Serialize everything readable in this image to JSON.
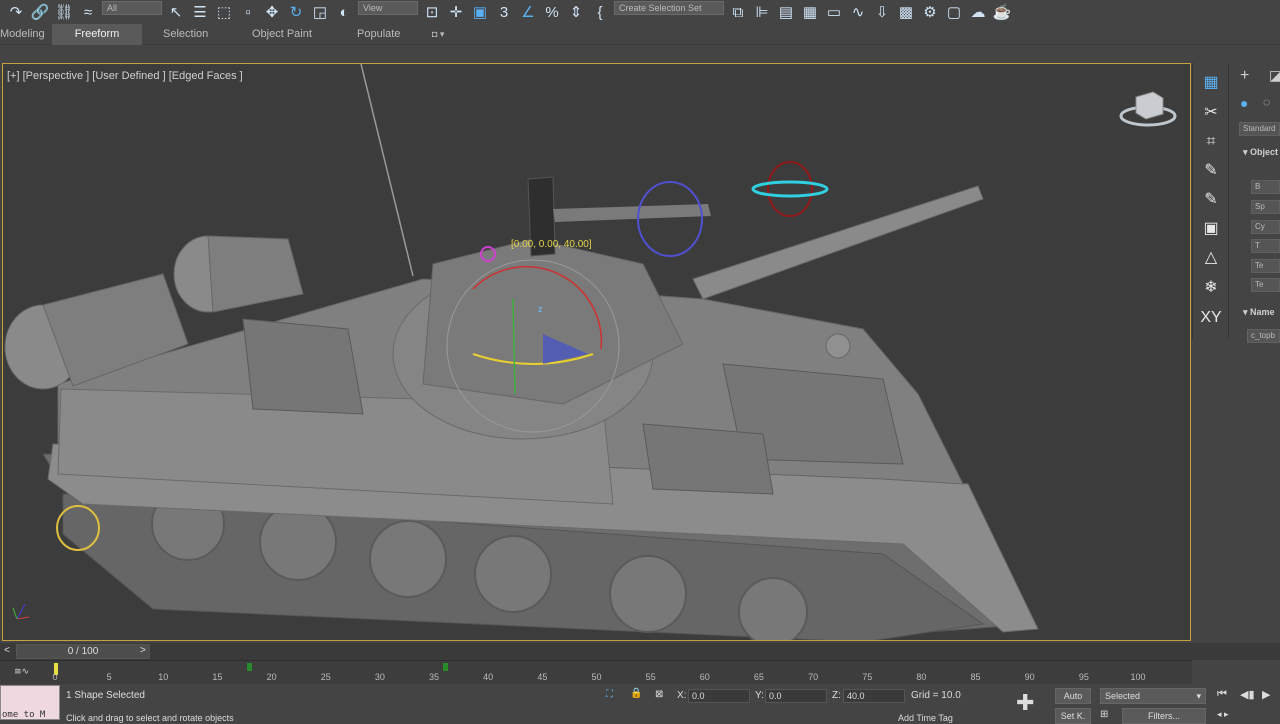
{
  "toolbar": {
    "filter_dropdown": "All",
    "view_dropdown": "View",
    "selection_set_dropdown": "Create Selection Set",
    "snap_value": "3"
  },
  "ribbon": {
    "tabs": [
      {
        "label": "Modeling"
      },
      {
        "label": "Freeform"
      },
      {
        "label": "Selection"
      },
      {
        "label": "Object Paint"
      },
      {
        "label": "Populate"
      }
    ],
    "active_tab": "Freeform"
  },
  "viewport": {
    "label": "[+] [Perspective ] [User Defined ] [Edged Faces ]",
    "gizmo_coordinate": "[0.00, 0.00, 40.00]",
    "axis_z": "z"
  },
  "command_panel": {
    "dropdown": "Standard",
    "rollout_object_type": "Object",
    "buttons": [
      "B",
      "Sp",
      "Cy",
      "T",
      "Te",
      "Te"
    ],
    "rollout_name": "Name",
    "name_value": "c_topb"
  },
  "timeline": {
    "slider_label": "0 / 100",
    "prev_arrow": "<",
    "next_arrow": ">",
    "ticks": [
      "0",
      "5",
      "10",
      "15",
      "20",
      "25",
      "30",
      "35",
      "40",
      "45",
      "50",
      "55",
      "60",
      "65",
      "70",
      "75",
      "80",
      "85",
      "90",
      "95",
      "100"
    ]
  },
  "status": {
    "maxscript_text": "ome to M",
    "selection_info": "1 Shape Selected",
    "prompt": "Click and drag to select and rotate objects",
    "x_label": "X:",
    "x_value": "0.0",
    "y_label": "Y:",
    "y_value": "0.0",
    "z_label": "Z:",
    "z_value": "40.0",
    "grid": "Grid = 10.0",
    "add_time_tag": "Add Time Tag",
    "auto_key": "Auto",
    "set_key": "Set K.",
    "key_mode": "Selected",
    "filters": "Filters..."
  },
  "colors": {
    "background": "#444444",
    "viewport": "#3c3c3c",
    "active_border": "#c8a040",
    "accent": "#5ab0f0"
  }
}
